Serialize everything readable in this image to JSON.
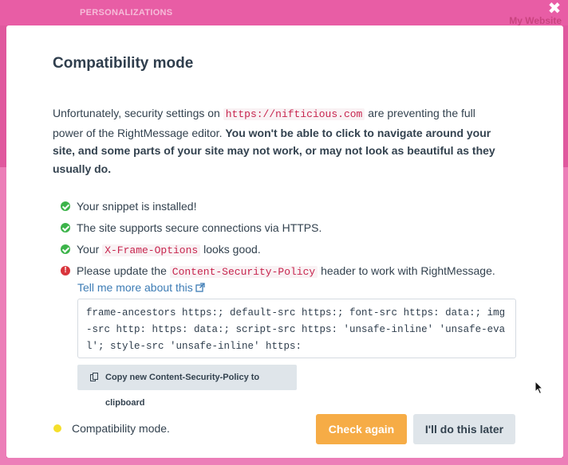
{
  "background": {
    "section_label": "PERSONALIZATIONS",
    "website_label": "My Website"
  },
  "modal": {
    "close_label": "✖",
    "title": "Compatibility mode",
    "intro": {
      "part1": "Unfortunately, security settings on ",
      "url": "https://nifticious.com",
      "part2": " are preventing the full power of the RightMessage editor. ",
      "bold": "You won't be able to click to navigate around your site, and some parts of your site may not work, or may not look as beautiful as they usually do."
    },
    "checks": [
      {
        "status": "ok",
        "text": "Your snippet is installed!"
      },
      {
        "status": "ok",
        "text": "The site supports secure connections via HTTPS."
      },
      {
        "status": "ok",
        "prefix": "Your ",
        "code": "X-Frame-Options",
        "suffix": " looks good."
      },
      {
        "status": "error",
        "prefix": "Please update the ",
        "code": "Content-Security-Policy",
        "suffix": " header to work with RightMessage."
      }
    ],
    "error_icon_glyph": "!",
    "tell_more_label": "Tell me more about this",
    "csp_value": "frame-ancestors https:; default-src https:; font-src https: data:; img-src http: https: data:; script-src https: 'unsafe-inline' 'unsafe-eval'; style-src 'unsafe-inline' https:",
    "copy_button_label": "Copy new Content-Security-Policy to clipboard",
    "status_label": "Compatibility mode.",
    "check_again_label": "Check again",
    "later_label": "I'll do this later"
  },
  "colors": {
    "background_pink": "#e0589e",
    "ok_green": "#3cb44a",
    "error_red": "#d9353c",
    "primary_orange": "#f6ac46",
    "secondary_gray": "#dfe5ea",
    "status_yellow": "#f5df2b",
    "link_blue": "#3d7cb5",
    "code_red": "#c7254e"
  },
  "icons": {
    "ok": "check-circle-icon",
    "error": "exclamation-circle-icon",
    "external": "external-link-icon",
    "copy": "copy-icon",
    "close": "close-icon",
    "status": "status-dot"
  }
}
